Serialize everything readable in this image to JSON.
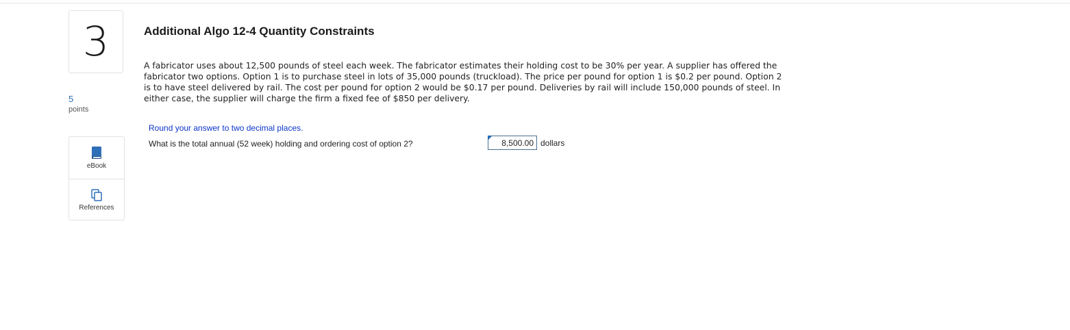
{
  "question": {
    "number": "3",
    "points_value": "5",
    "points_label": "points",
    "title": "Additional Algo 12-4 Quantity Constraints",
    "prompt": "A fabricator uses about 12,500 pounds of steel each week. The fabricator estimates their holding cost to be 30% per year. A supplier has offered the fabricator two options. Option 1 is to purchase steel in lots of 35,000 pounds (truckload). The price per pound for option 1 is $0.2 per pound. Option 2 is to have steel delivered by rail. The cost per pound for option 2 would be $0.17 per pound. Deliveries by rail will include 150,000 pounds of steel. In either case, the supplier will charge the firm a fixed fee of $850 per delivery.",
    "instruction": "Round your answer to two decimal places.",
    "sub_question": "What is the total annual (52 week) holding and ordering cost of option 2?",
    "answer_value": "8,500.00",
    "answer_unit": "dollars"
  },
  "tools": {
    "ebook_label": "eBook",
    "references_label": "References"
  },
  "icons": {
    "ebook": "book-icon",
    "references": "copy-pages-icon"
  },
  "colors": {
    "accent_blue": "#2b6cb0",
    "instruction_blue": "#0b34cc"
  }
}
